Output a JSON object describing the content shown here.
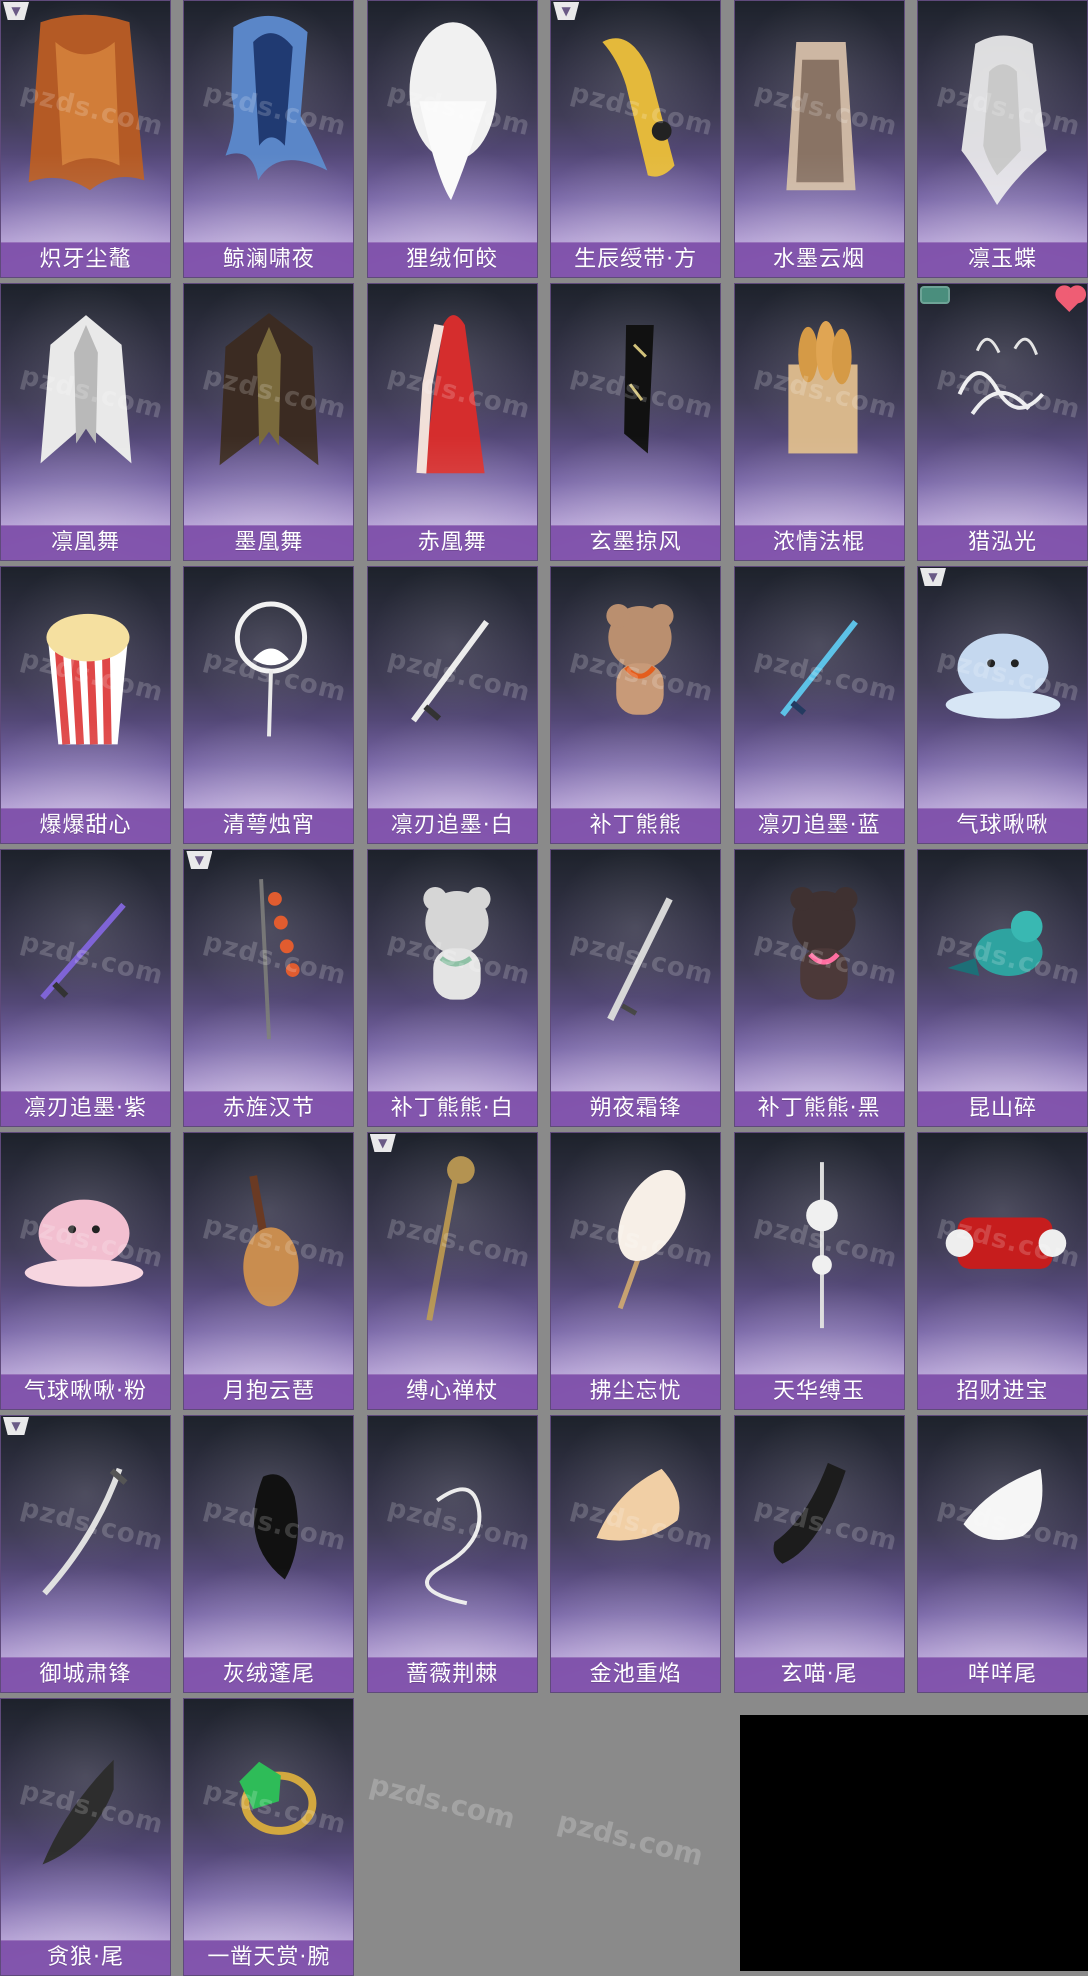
{
  "watermark": "pzds.com",
  "items": [
    {
      "name": "炽牙尘鼇",
      "icon": "orange-cape-icon",
      "corner": "triangle"
    },
    {
      "name": "鲸澜啸夜",
      "icon": "blue-cape-icon",
      "corner": ""
    },
    {
      "name": "狸绒何皎",
      "icon": "white-hair-icon",
      "corner": ""
    },
    {
      "name": "生辰绶带·方",
      "icon": "gold-ribbon-icon",
      "corner": "triangle"
    },
    {
      "name": "水墨云烟",
      "icon": "ink-robe-icon",
      "corner": ""
    },
    {
      "name": "凛玉蝶",
      "icon": "white-cape-icon",
      "corner": ""
    },
    {
      "name": "凛凰舞",
      "icon": "silver-wings-icon",
      "corner": ""
    },
    {
      "name": "墨凰舞",
      "icon": "black-wings-icon",
      "corner": ""
    },
    {
      "name": "赤凰舞",
      "icon": "red-gown-icon",
      "corner": ""
    },
    {
      "name": "玄墨掠风",
      "icon": "black-scarf-icon",
      "corner": ""
    },
    {
      "name": "浓情法棍",
      "icon": "bread-bag-icon",
      "corner": ""
    },
    {
      "name": "猎泓光",
      "icon": "light-wisps-icon",
      "corner": "badge-heart"
    },
    {
      "name": "爆爆甜心",
      "icon": "popcorn-icon",
      "corner": ""
    },
    {
      "name": "清萼烛宵",
      "icon": "lotus-staff-icon",
      "corner": ""
    },
    {
      "name": "凛刃追墨·白",
      "icon": "white-sword-icon",
      "corner": ""
    },
    {
      "name": "补丁熊熊",
      "icon": "patch-bear-icon",
      "corner": ""
    },
    {
      "name": "凛刃追墨·蓝",
      "icon": "blue-sword-icon",
      "corner": ""
    },
    {
      "name": "气球啾啾",
      "icon": "blue-balloon-icon",
      "corner": "triangle"
    },
    {
      "name": "凛刃追墨·紫",
      "icon": "purple-sword-icon",
      "corner": ""
    },
    {
      "name": "赤旌汉节",
      "icon": "red-tassel-staff-icon",
      "corner": "triangle"
    },
    {
      "name": "补丁熊熊·白",
      "icon": "white-patch-bear-icon",
      "corner": ""
    },
    {
      "name": "朔夜霜锋",
      "icon": "silver-blade-icon",
      "corner": ""
    },
    {
      "name": "补丁熊熊·黑",
      "icon": "black-patch-bear-icon",
      "corner": ""
    },
    {
      "name": "昆山碎",
      "icon": "teal-bird-icon",
      "corner": ""
    },
    {
      "name": "气球啾啾·粉",
      "icon": "pink-balloon-icon",
      "corner": ""
    },
    {
      "name": "月抱云琶",
      "icon": "pipa-icon",
      "corner": ""
    },
    {
      "name": "缚心禅杖",
      "icon": "zen-staff-icon",
      "corner": "triangle"
    },
    {
      "name": "拂尘忘忧",
      "icon": "whisk-icon",
      "corner": ""
    },
    {
      "name": "天华缚玉",
      "icon": "jade-pendant-icon",
      "corner": ""
    },
    {
      "name": "招财进宝",
      "icon": "red-scroll-icon",
      "corner": ""
    },
    {
      "name": "御城肃锋",
      "icon": "curved-sword-icon",
      "corner": "triangle"
    },
    {
      "name": "灰绒蓬尾",
      "icon": "black-tail-icon",
      "corner": ""
    },
    {
      "name": "蔷薇荆棘",
      "icon": "thorn-whip-icon",
      "corner": ""
    },
    {
      "name": "金池重焰",
      "icon": "gold-tail-icon",
      "corner": ""
    },
    {
      "name": "玄喵·尾",
      "icon": "black-cat-tail-icon",
      "corner": ""
    },
    {
      "name": "咩咩尾",
      "icon": "white-tail-icon",
      "corner": ""
    },
    {
      "name": "贪狼·尾",
      "icon": "dark-feather-tail-icon",
      "corner": ""
    },
    {
      "name": "一凿天赏·腕",
      "icon": "emerald-bracelet-icon",
      "corner": ""
    }
  ]
}
